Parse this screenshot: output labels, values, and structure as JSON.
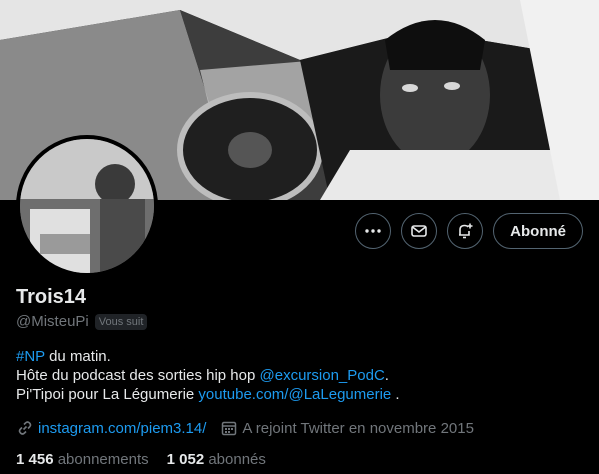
{
  "profile": {
    "display_name": "Trois14",
    "handle": "@MisteuPi",
    "follows_you_badge": "Vous suit",
    "follow_button_label": "Abonné",
    "bio": {
      "line1_hashtag": "#NP",
      "line1_rest": " du matin.",
      "line2_text": "Hôte du podcast des sorties hip hop ",
      "line2_mention": "@excursion_PodC",
      "line2_end": ".",
      "line3_text": "Pi'Tipoi pour La Légumerie ",
      "line3_link": "youtube.com/@LaLegumerie",
      "line3_end": " ."
    },
    "website": "instagram.com/piem3.14/",
    "joined": "A rejoint Twitter en novembre 2015",
    "following_count": "1 456",
    "following_label": "abonnements",
    "followers_count": "1 052",
    "followers_label": "abonnés"
  },
  "icons": {
    "more": "more-icon",
    "message": "envelope-icon",
    "notify": "bell-plus-icon",
    "link": "link-icon",
    "calendar": "calendar-icon"
  },
  "colors": {
    "accent": "#1d9bf0",
    "muted": "#71767b",
    "text": "#e7e9ea",
    "background": "#000000"
  }
}
